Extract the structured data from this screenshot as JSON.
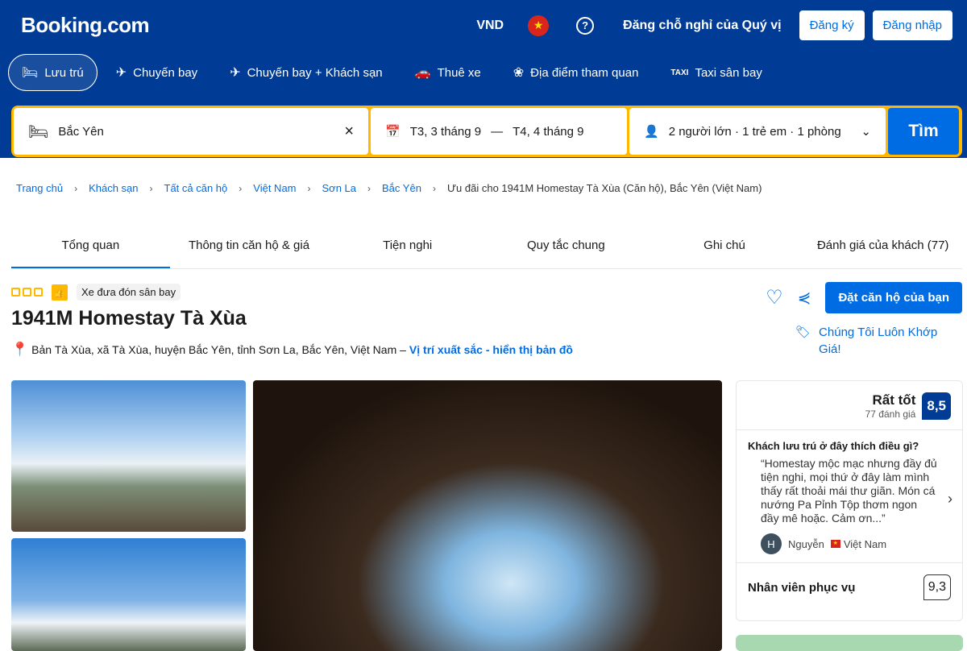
{
  "header": {
    "logo": "Booking.com",
    "currency": "VND",
    "flag_icon": "vietnam-flag-icon",
    "help_icon": "help-icon",
    "list_property": "Đăng chỗ nghỉ của Quý vị",
    "register": "Đăng ký",
    "login": "Đăng nhập"
  },
  "nav": [
    {
      "label": "Lưu trú",
      "icon": "bed-icon",
      "active": true
    },
    {
      "label": "Chuyến bay",
      "icon": "plane-icon"
    },
    {
      "label": "Chuyến bay + Khách sạn",
      "icon": "plane-hotel-icon"
    },
    {
      "label": "Thuê xe",
      "icon": "car-icon"
    },
    {
      "label": "Địa điểm tham quan",
      "icon": "attractions-icon"
    },
    {
      "label": "Taxi sân bay",
      "icon": "taxi-icon"
    }
  ],
  "search": {
    "destination": "Bắc Yên",
    "checkin": "T3, 3 tháng 9",
    "dash": "—",
    "checkout": "T4, 4 tháng 9",
    "guests": "2 người lớn · 1 trẻ em · 1 phòng",
    "button": "Tìm"
  },
  "breadcrumb": [
    "Trang chủ",
    "Khách sạn",
    "Tất cả căn hộ",
    "Việt Nam",
    "Sơn La",
    "Bắc Yên"
  ],
  "breadcrumb_current": "Ưu đãi cho 1941M Homestay Tà Xùa (Căn hộ), Bắc Yên (Việt Nam)",
  "tabs": [
    "Tổng quan",
    "Thông tin căn hộ & giá",
    "Tiện nghi",
    "Quy tắc chung",
    "Ghi chú",
    "Đánh giá của khách (77)"
  ],
  "property": {
    "rating_squares": 3,
    "badge": "Xe đưa đón sân bay",
    "name": "1941M Homestay Tà Xùa",
    "address": "Bản Tà Xùa, xã Tà Xùa, huyện Bắc Yên, tỉnh Sơn La, Bắc Yên, Việt Nam –",
    "map_link": "Vị trí xuất sắc - hiển thị bản đồ",
    "book": "Đặt căn hộ của bạn",
    "price_match": "Chúng Tôi Luôn Khớp Giá!"
  },
  "review": {
    "label": "Rất tốt",
    "count": "77 đánh giá",
    "score": "8,5",
    "question": "Khách lưu trú ở đây thích điều gì?",
    "quote": "“Homestay mộc mạc nhưng đầy đủ tiện nghi, mọi thứ ở đây làm mình thấy rất thoải mái thư giãn. Món cá nướng Pa Pỉnh Tộp thơm ngon đầy mê hoặc. Cảm ơn...”",
    "avatar": "H",
    "author": "Nguyễn",
    "country": "Việt Nam",
    "staff_label": "Nhân viên phục vụ",
    "staff_score": "9,3"
  },
  "colors": {
    "brand": "#003b95",
    "accent": "#006ce4",
    "search_border": "#ffb700"
  }
}
